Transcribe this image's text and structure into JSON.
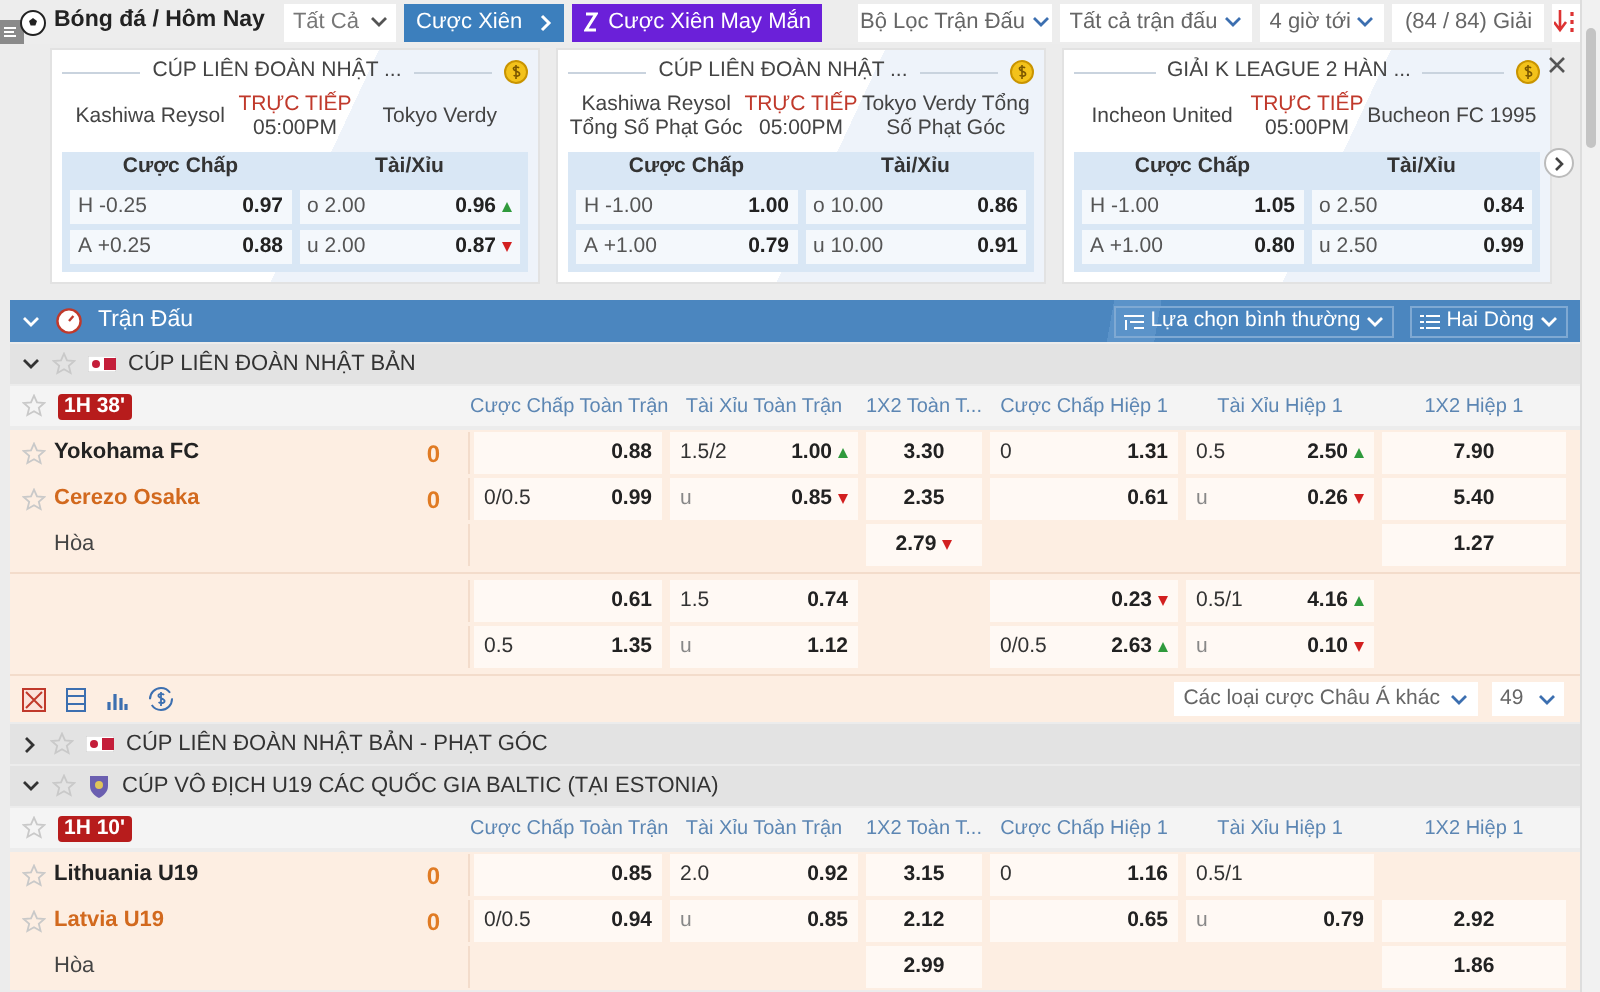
{
  "topbar": {
    "title": "Bóng đá / Hôm Nay",
    "market_select": {
      "value": "Tất Cả"
    },
    "buttons": [
      {
        "label": "Cược Xiên",
        "kind": "parlay"
      },
      {
        "label": "Cược Xiên May Mắn",
        "kind": "lucky"
      }
    ],
    "filters": [
      "Bộ Lọc Trận Đấu",
      "Tất cả trận đấu",
      "4 giờ tới"
    ],
    "league_count": "(84 / 84) Giải"
  },
  "featured_matches": [
    {
      "league": "CÚP LIÊN ĐOÀN NHẬT ...",
      "home": "Kashiwa Reysol",
      "status": "TRỰC TIẾP",
      "time": "05:00PM",
      "away": "Tokyo Verdy",
      "handicap_heading": "Cược Chấp",
      "total_heading": "Tài/Xỉu",
      "rows": [
        {
          "side": "H",
          "handicap": "-0.25",
          "handicap_odds": "0.97",
          "total_side": "o",
          "total": "2.00",
          "total_odds": "0.96",
          "kind": "rising"
        },
        {
          "side": "A",
          "handicap": "+0.25",
          "handicap_odds": "0.88",
          "total_side": "u",
          "total": "2.00",
          "total_odds": "0.87",
          "kind": "falling"
        }
      ]
    },
    {
      "league": "CÚP LIÊN ĐOÀN NHẬT ...",
      "home": "Kashiwa Reysol Tổng Số Phạt Góc",
      "status": "TRỰC TIẾP",
      "time": "05:00PM",
      "away": "Tokyo Verdy Tổng Số Phạt Góc",
      "handicap_heading": "Cược Chấp",
      "total_heading": "Tài/Xỉu",
      "rows": [
        {
          "side": "H",
          "handicap": "-1.00",
          "handicap_odds": "1.00",
          "total_side": "o",
          "total": "10.00",
          "total_odds": "0.86"
        },
        {
          "side": "A",
          "handicap": "+1.00",
          "handicap_odds": "0.79",
          "total_side": "u",
          "total": "10.00",
          "total_odds": "0.91"
        }
      ]
    },
    {
      "league": "GIẢI K LEAGUE 2 HÀN ...",
      "home": "Incheon United",
      "status": "TRỰC TIẾP",
      "time": "05:00PM",
      "away": "Bucheon FC 1995",
      "handicap_heading": "Cược Chấp",
      "total_heading": "Tài/Xỉu",
      "rows": [
        {
          "side": "H",
          "handicap": "-1.00",
          "handicap_odds": "1.05",
          "total_side": "o",
          "total": "2.50",
          "total_odds": "0.84"
        },
        {
          "side": "A",
          "handicap": "+1.00",
          "handicap_odds": "0.80",
          "total_side": "u",
          "total": "2.50",
          "total_odds": "0.99"
        }
      ]
    }
  ],
  "section": {
    "title": "Trận Đấu",
    "options": [
      "Lựa chọn bình thường",
      "Hai Dòng"
    ]
  },
  "leagues": [
    {
      "name": "CÚP LIÊN ĐOÀN NHẬT BẢN",
      "expanded": true,
      "kind": "flag",
      "matches": [
        {
          "clock": "1H 38'",
          "columns": [
            "Cược Chấp Toàn Trận",
            "Tài Xỉu Toàn Trận",
            "1X2 Toàn T...",
            "Cược Chấp Hiệp 1",
            "Tài Xỉu Hiệp 1",
            "1X2 Hiệp 1"
          ],
          "teams": [
            {
              "name": "Yokohama FC",
              "score": "0",
              "kind": "home"
            },
            {
              "name": "Cerezo Osaka",
              "score": "0",
              "kind": "away"
            }
          ],
          "draw": "Hòa",
          "rows": [
            [
              {
                "odds": "0.88"
              },
              {
                "line": "1.5/2",
                "odds": "1.00",
                "kind": "rising"
              },
              {
                "odds": "3.30"
              },
              {
                "line": "0",
                "odds": "1.31"
              },
              {
                "line": "0.5",
                "odds": "2.50",
                "kind": "rising"
              },
              {
                "odds": "7.90"
              }
            ],
            [
              {
                "line": "0/0.5",
                "odds": "0.99"
              },
              {
                "line": "u",
                "odds": "0.85",
                "kind": "falling"
              },
              {
                "odds": "2.35"
              },
              {
                "odds": "0.61"
              },
              {
                "line": "u",
                "odds": "0.26",
                "kind": "falling"
              },
              {
                "odds": "5.40"
              }
            ],
            [
              null,
              null,
              {
                "odds": "2.79",
                "kind": "falling"
              },
              null,
              null,
              {
                "odds": "1.27"
              }
            ]
          ],
          "extra_rows": [
            [
              {
                "odds": "0.61"
              },
              {
                "line": "1.5",
                "odds": "0.74"
              },
              null,
              {
                "odds": "0.23",
                "kind": "falling"
              },
              {
                "line": "0.5/1",
                "odds": "4.16",
                "kind": "rising"
              },
              null
            ],
            [
              {
                "line": "0.5",
                "odds": "1.35"
              },
              {
                "line": "u",
                "odds": "1.12"
              },
              null,
              {
                "line": "0/0.5",
                "odds": "2.63",
                "kind": "rising"
              },
              {
                "line": "u",
                "odds": "0.10",
                "kind": "falling"
              },
              null
            ]
          ],
          "toolbar": {
            "more_markets": "Các loại cược Châu Á khác",
            "count": "49"
          }
        }
      ]
    },
    {
      "name": "CÚP LIÊN ĐOÀN NHẬT BẢN - PHẠT GÓC",
      "expanded": false,
      "kind": "flag"
    },
    {
      "name": "CÚP VÔ ĐỊCH U19 CÁC QUỐC GIA BALTIC (TẠI ESTONIA)",
      "expanded": true,
      "kind": "crest",
      "matches": [
        {
          "clock": "1H 10'",
          "columns": [
            "Cược Chấp Toàn Trận",
            "Tài Xỉu Toàn Trận",
            "1X2 Toàn T...",
            "Cược Chấp Hiệp 1",
            "Tài Xỉu Hiệp 1",
            "1X2 Hiệp 1"
          ],
          "teams": [
            {
              "name": "Lithuania U19",
              "score": "0",
              "kind": "home"
            },
            {
              "name": "Latvia U19",
              "score": "0",
              "kind": "away"
            }
          ],
          "draw": "Hòa",
          "rows": [
            [
              {
                "odds": "0.85"
              },
              {
                "line": "2.0",
                "odds": "0.92"
              },
              {
                "odds": "3.15"
              },
              {
                "line": "0",
                "odds": "1.16"
              },
              {
                "line": "0.5/1"
              },
              null
            ],
            [
              {
                "line": "0/0.5",
                "odds": "0.94"
              },
              {
                "line": "u",
                "odds": "0.85"
              },
              {
                "odds": "2.12"
              },
              {
                "odds": "0.65"
              },
              {
                "line": "u",
                "odds": "0.79"
              },
              {
                "odds": "2.92"
              }
            ],
            [
              null,
              null,
              {
                "odds": "2.99"
              },
              null,
              null,
              {
                "odds": "1.86"
              }
            ]
          ]
        }
      ]
    }
  ]
}
